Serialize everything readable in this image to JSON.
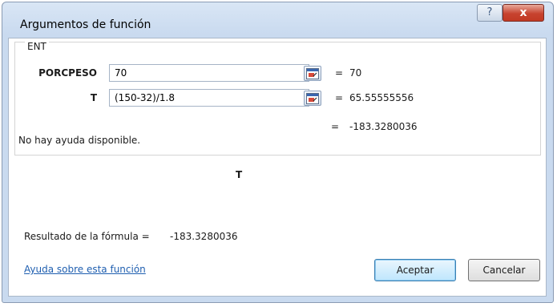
{
  "window": {
    "title": "Argumentos de función",
    "help_button": "?",
    "close_button": "x"
  },
  "function": {
    "name": "ENT",
    "arguments": [
      {
        "label": "PORCPESO",
        "value": "70",
        "result": "70"
      },
      {
        "label": "T",
        "value": "(150-32)/1.8",
        "result": "65.55555556"
      }
    ],
    "equals": "=",
    "function_result": "-183.3280036",
    "help_text": "No hay ayuda disponible.",
    "current_argument": "T"
  },
  "footer": {
    "formula_result_label": "Resultado de la fórmula =",
    "formula_result_value": "-183.3280036",
    "help_link": "Ayuda sobre esta función",
    "ok_button": "Aceptar",
    "cancel_button": "Cancelar"
  }
}
